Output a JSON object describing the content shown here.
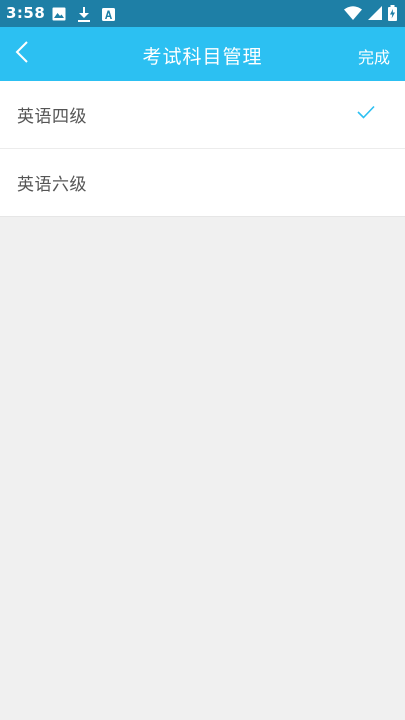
{
  "status_bar": {
    "time": "3:58",
    "left_icons": [
      "image-icon",
      "download-icon",
      "font-icon"
    ],
    "right_icons": [
      "wifi-icon",
      "signal-icon",
      "battery-icon"
    ]
  },
  "app_bar": {
    "back_icon": "chevron-left-icon",
    "title": "考试科目管理",
    "done_label": "完成",
    "background": "#2cc0f2"
  },
  "subjects": {
    "items": [
      {
        "label": "英语四级",
        "selected": true
      },
      {
        "label": "英语六级",
        "selected": false
      }
    ],
    "check_color": "#2cc0f2"
  }
}
